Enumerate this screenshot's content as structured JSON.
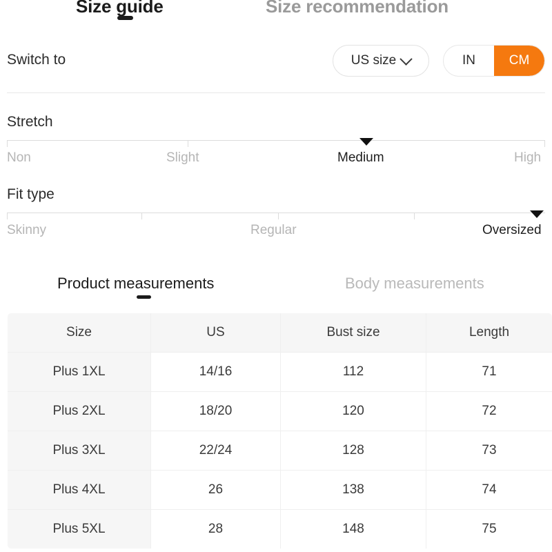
{
  "top_tabs": [
    {
      "label": "Size guide",
      "active": true
    },
    {
      "label": "Size recommendation",
      "active": false
    }
  ],
  "switch": {
    "label": "Switch to",
    "size_system": {
      "value": "US size",
      "icon": "chevron-down-icon"
    },
    "units": [
      {
        "label": "IN",
        "selected": false
      },
      {
        "label": "CM",
        "selected": true
      }
    ]
  },
  "stretch": {
    "title": "Stretch",
    "labels": [
      "Non",
      "Slight",
      "Medium",
      "High"
    ],
    "selected": "Medium"
  },
  "fit_type": {
    "title": "Fit type",
    "labels": [
      "Skinny",
      "Regular",
      "Oversized"
    ],
    "selected": "Oversized"
  },
  "measurement_tabs": [
    {
      "label": "Product measurements",
      "active": true
    },
    {
      "label": "Body measurements",
      "active": false
    }
  ],
  "table": {
    "headers": [
      "Size",
      "US",
      "Bust size",
      "Length"
    ],
    "rows": [
      [
        "Plus 1XL",
        "14/16",
        "112",
        "71"
      ],
      [
        "Plus 2XL",
        "18/20",
        "120",
        "72"
      ],
      [
        "Plus 3XL",
        "22/24",
        "128",
        "73"
      ],
      [
        "Plus 4XL",
        "26",
        "138",
        "74"
      ],
      [
        "Plus 5XL",
        "28",
        "148",
        "75"
      ]
    ]
  },
  "colors": {
    "accent": "#f5790f",
    "active_text": "#1b1b1b",
    "muted_text": "#b5b5b5",
    "header_bg": "#f6f6f6",
    "border": "#efefef"
  }
}
